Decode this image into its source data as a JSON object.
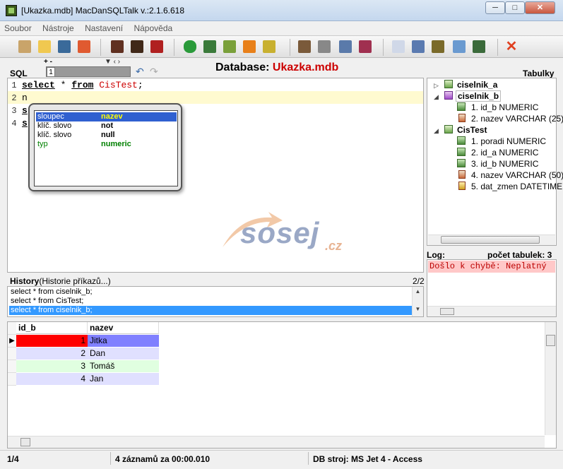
{
  "window": {
    "title": "[Ukazka.mdb] MacDanSQLTalk v.:2.1.6.618"
  },
  "menu": {
    "items": [
      "Soubor",
      "Nástroje",
      "Nastavení",
      "Nápověda"
    ]
  },
  "editor": {
    "sql_label": "SQL",
    "tab_plusminus": "+ -",
    "tab_controls": "▼ ‹ ›",
    "tab_number": "1",
    "lines": [
      {
        "num": "1",
        "select": "select",
        "star": " * ",
        "from": "from",
        "table": " CisTest",
        "semi": ";"
      },
      {
        "num": "2",
        "text": "n"
      },
      {
        "num": "3",
        "text": "s"
      },
      {
        "num": "4",
        "text": "s"
      }
    ]
  },
  "database": {
    "label": "Database: ",
    "name": "Ukazka.mdb"
  },
  "autocomplete": {
    "items": [
      {
        "kind": "sloupec",
        "value": "nazev",
        "color": "#ffff00"
      },
      {
        "kind": "klíč. slovo",
        "value": "not",
        "color": "#000000"
      },
      {
        "kind": "klíč. slovo",
        "value": "null",
        "color": "#000000"
      },
      {
        "kind": "typ",
        "value": "numeric",
        "color": "#008000"
      }
    ]
  },
  "watermark": {
    "text": "sosej",
    "suffix": ".cz"
  },
  "history": {
    "title": "History",
    "subtitle": "(Historie příkazů...)",
    "count": "2/2",
    "items": [
      "select * from ciselnik_b;",
      "select * from CisTest;",
      "select * from ciselnik_b;"
    ]
  },
  "tree": {
    "label": "Tabulky",
    "tables": [
      {
        "name": "ciselnik_a",
        "columns": []
      },
      {
        "name": "ciselnik_b",
        "columns": [
          "1. id_b NUMERIC",
          "2. nazev VARCHAR (25)"
        ]
      },
      {
        "name": "CisTest",
        "columns": [
          "1. poradi NUMERIC",
          "2. id_a NUMERIC",
          "3. id_b NUMERIC",
          "4. nazev VARCHAR (50)",
          "5. dat_zmen DATETIME"
        ]
      }
    ]
  },
  "log": {
    "label": "Log:",
    "count": "počet tabulek: 3",
    "error": "Došlo k chybě: Neplatný"
  },
  "grid": {
    "columns": [
      "id_b",
      "nazev"
    ],
    "rows": [
      {
        "id_b": "1",
        "nazev": "Jitka",
        "color": "#ff0000",
        "name_color": "#8080ff"
      },
      {
        "id_b": "2",
        "nazev": "Dan",
        "color": "#e0e0ff",
        "name_color": "#e0e0ff"
      },
      {
        "id_b": "3",
        "nazev": "Tomáš",
        "color": "#e0ffe0",
        "name_color": "#e0ffe0"
      },
      {
        "id_b": "4",
        "nazev": "Jan",
        "color": "#e0e0ff",
        "name_color": "#e0e0ff"
      }
    ]
  },
  "status": {
    "position": "1/4",
    "records": "4 záznamů za 00:00.010",
    "engine": "DB stroj: MS Jet 4 - Access"
  }
}
